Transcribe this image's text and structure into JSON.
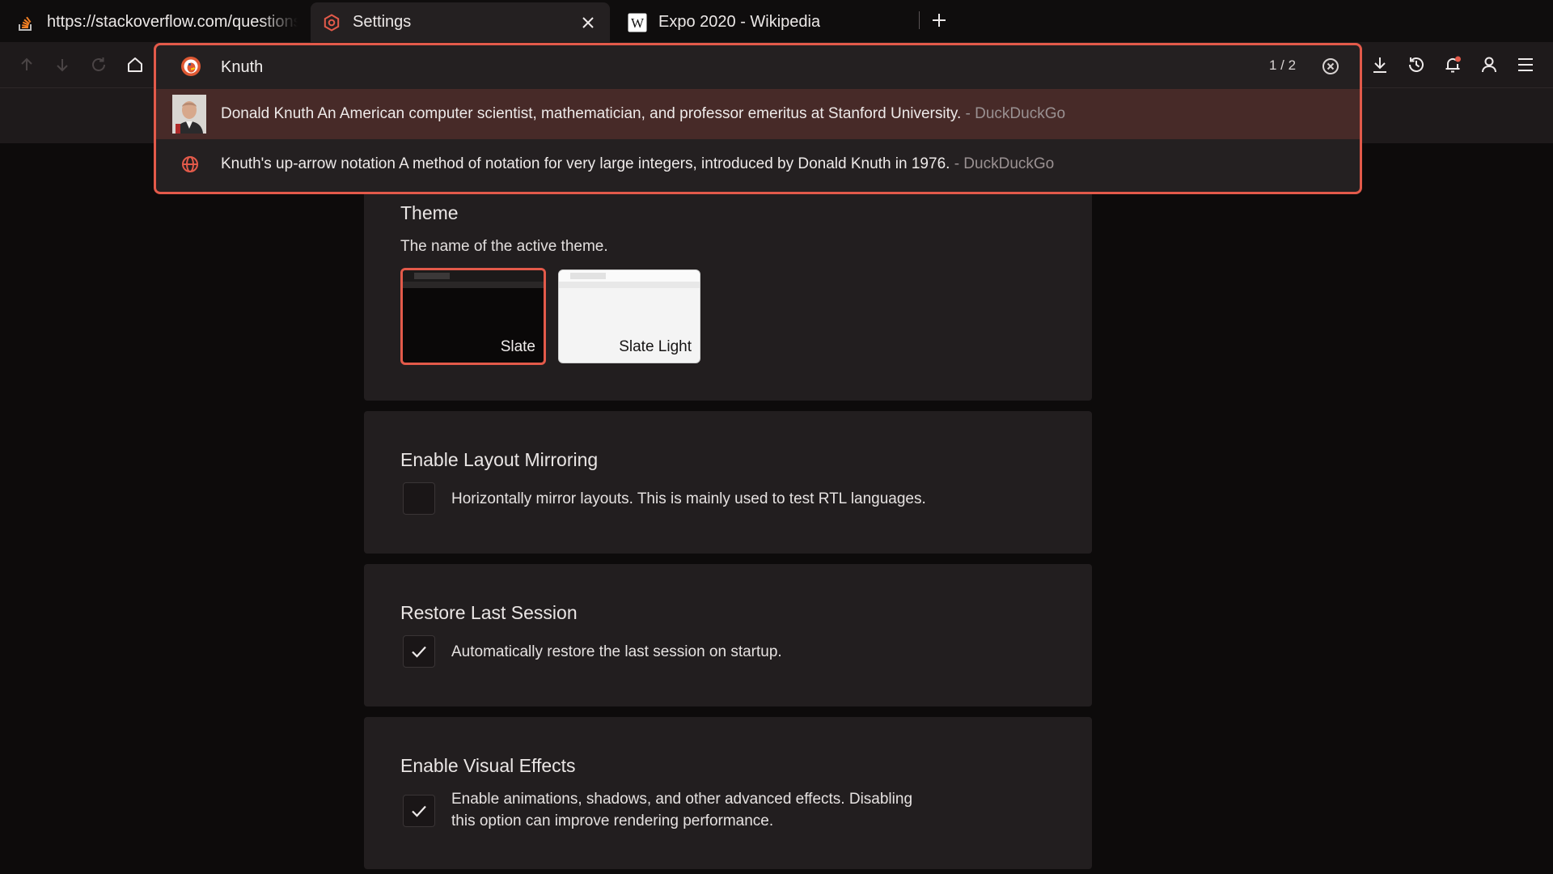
{
  "tabs": [
    {
      "title": "https://stackoverflow.com/questions",
      "icon": "stackoverflow-icon"
    },
    {
      "title": "Settings",
      "icon": "settings-hexagon-icon",
      "active": true
    },
    {
      "title": "Expo 2020 - Wikipedia",
      "icon": "wikipedia-icon"
    }
  ],
  "omnibox": {
    "value": "Knuth",
    "match_count": "1 / 2",
    "suggestions": [
      {
        "text": "Donald Knuth An American computer scientist, mathematician, and professor emeritus at Stanford University.",
        "source": " - DuckDuckGo",
        "icon": "person-thumbnail",
        "highlighted": true
      },
      {
        "text": "Knuth's up-arrow notation A method of notation for very large integers, introduced by Donald Knuth in 1976.",
        "source": " - DuckDuckGo",
        "icon": "globe-icon"
      }
    ]
  },
  "settings": {
    "theme": {
      "title": "Theme",
      "description": "The name of the active theme.",
      "options": [
        {
          "label": "Slate",
          "selected": true
        },
        {
          "label": "Slate Light",
          "selected": false
        }
      ]
    },
    "layout_mirroring": {
      "title": "Enable Layout Mirroring",
      "label": "Horizontally mirror layouts. This is mainly used to test RTL languages.",
      "checked": false
    },
    "restore_session": {
      "title": "Restore Last Session",
      "label": "Automatically restore the last session on startup.",
      "checked": true
    },
    "visual_effects": {
      "title": "Enable Visual Effects",
      "label_line1": "Enable animations, shadows, and other advanced effects. Disabling",
      "label_line2": "this option can improve rendering performance.",
      "checked": true
    }
  },
  "colors": {
    "accent": "#e35a4a",
    "background": "#0d0b0b",
    "card": "#221e1f",
    "highlight": "#472a28"
  }
}
